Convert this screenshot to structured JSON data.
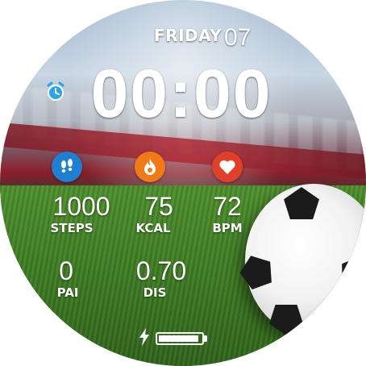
{
  "date": {
    "day_of_week": "FRIDAY",
    "day": "07"
  },
  "time": {
    "display": "00:00"
  },
  "icons": {
    "alarm": "alarm-clock-icon",
    "steps": "footprints-icon",
    "kcal": "flame-icon",
    "bpm": "heart-icon",
    "charge": "lightning-bolt-icon"
  },
  "colors": {
    "alarm": "#2aa3e8",
    "steps": "#1f7fd0",
    "kcal": "#f07a18",
    "bpm": "#e0402a",
    "text": "#ffffff"
  },
  "stats": {
    "steps": {
      "value": "1000",
      "label": "STEPS"
    },
    "kcal": {
      "value": "75",
      "label": "KCAL"
    },
    "bpm": {
      "value": "72",
      "label": "BPM"
    },
    "pai": {
      "value": "0",
      "label": "PAI"
    },
    "dis": {
      "value": "0.70",
      "label": "DIS"
    }
  },
  "battery": {
    "level_fraction": 0.95
  }
}
